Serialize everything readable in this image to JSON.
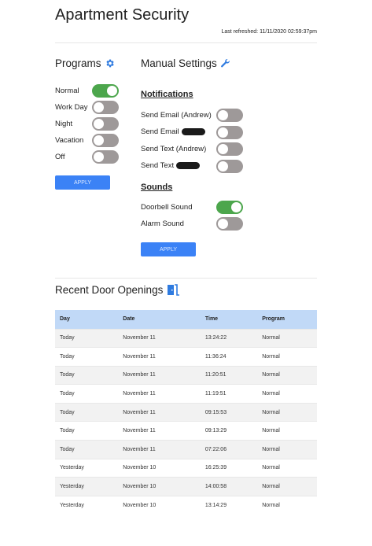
{
  "header": {
    "title": "Apartment Security",
    "refreshed": "Last refreshed: 11/11/2020 02:59:37pm"
  },
  "programs": {
    "title": "Programs",
    "icon": "gear-icon",
    "items": [
      {
        "label": "Normal",
        "on": true
      },
      {
        "label": "Work Day",
        "on": false
      },
      {
        "label": "Night",
        "on": false
      },
      {
        "label": "Vacation",
        "on": false
      },
      {
        "label": "Off",
        "on": false
      }
    ],
    "apply": "APPLY"
  },
  "manual": {
    "title": "Manual Settings",
    "icon": "wrench-icon",
    "notifications_title": "Notifications",
    "notifications": [
      {
        "label": "Send Email (Andrew)",
        "on": false,
        "redacted": false
      },
      {
        "label": "Send Email",
        "on": false,
        "redacted": true
      },
      {
        "label": "Send Text (Andrew)",
        "on": false,
        "redacted": false
      },
      {
        "label": "Send Text",
        "on": false,
        "redacted": true
      }
    ],
    "sounds_title": "Sounds",
    "sounds": [
      {
        "label": "Doorbell Sound",
        "on": true
      },
      {
        "label": "Alarm Sound",
        "on": false
      }
    ],
    "apply": "APPLY"
  },
  "openings": {
    "title": "Recent Door Openings",
    "icon": "door-icon",
    "columns": [
      "Day",
      "Date",
      "Time",
      "Program"
    ],
    "rows": [
      [
        "Today",
        "November 11",
        "13:24:22",
        "Normal"
      ],
      [
        "Today",
        "November 11",
        "11:36:24",
        "Normal"
      ],
      [
        "Today",
        "November 11",
        "11:20:51",
        "Normal"
      ],
      [
        "Today",
        "November 11",
        "11:19:51",
        "Normal"
      ],
      [
        "Today",
        "November 11",
        "09:15:53",
        "Normal"
      ],
      [
        "Today",
        "November 11",
        "09:13:29",
        "Normal"
      ],
      [
        "Today",
        "November 11",
        "07:22:06",
        "Normal"
      ],
      [
        "Yesterday",
        "November 10",
        "16:25:39",
        "Normal"
      ],
      [
        "Yesterday",
        "November 10",
        "14:00:58",
        "Normal"
      ],
      [
        "Yesterday",
        "November 10",
        "13:14:29",
        "Normal"
      ]
    ]
  },
  "colors": {
    "accent": "#3b82f6",
    "toggle_on": "#4ca64c",
    "toggle_off": "#9e9999",
    "table_header": "#c1d9f7"
  }
}
